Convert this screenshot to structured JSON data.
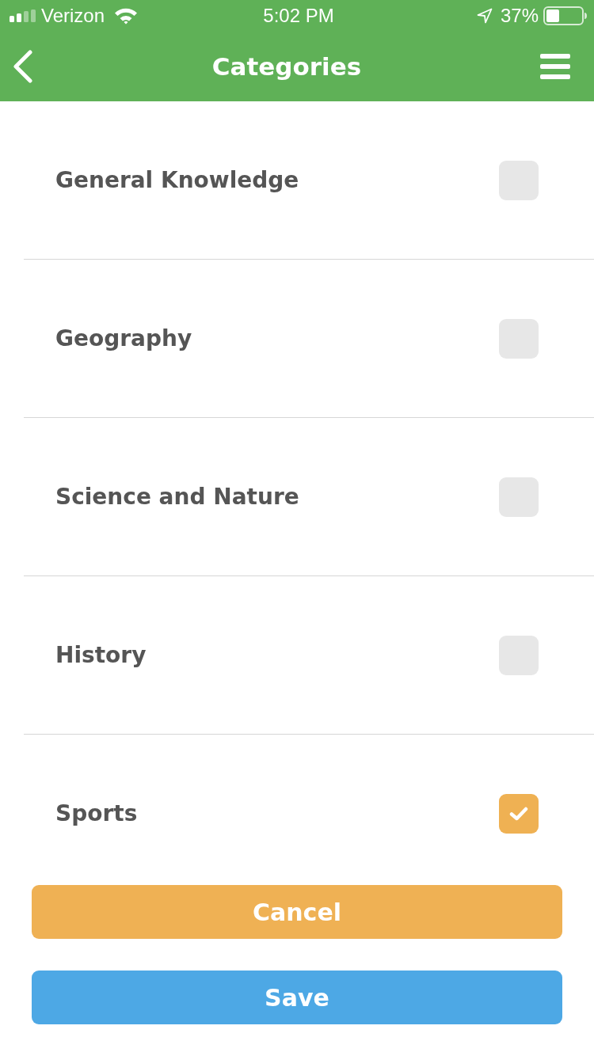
{
  "status_bar": {
    "carrier": "Verizon",
    "time": "5:02 PM",
    "battery": "37%"
  },
  "nav_bar": {
    "title": "Categories"
  },
  "categories": [
    {
      "label": "General Knowledge",
      "checked": false
    },
    {
      "label": "Geography",
      "checked": false
    },
    {
      "label": "Science and Nature",
      "checked": false
    },
    {
      "label": "History",
      "checked": false
    },
    {
      "label": "Sports",
      "checked": true
    }
  ],
  "buttons": [
    {
      "label": "Cancel",
      "kind": "cancel"
    },
    {
      "label": "Save",
      "kind": "save"
    }
  ]
}
